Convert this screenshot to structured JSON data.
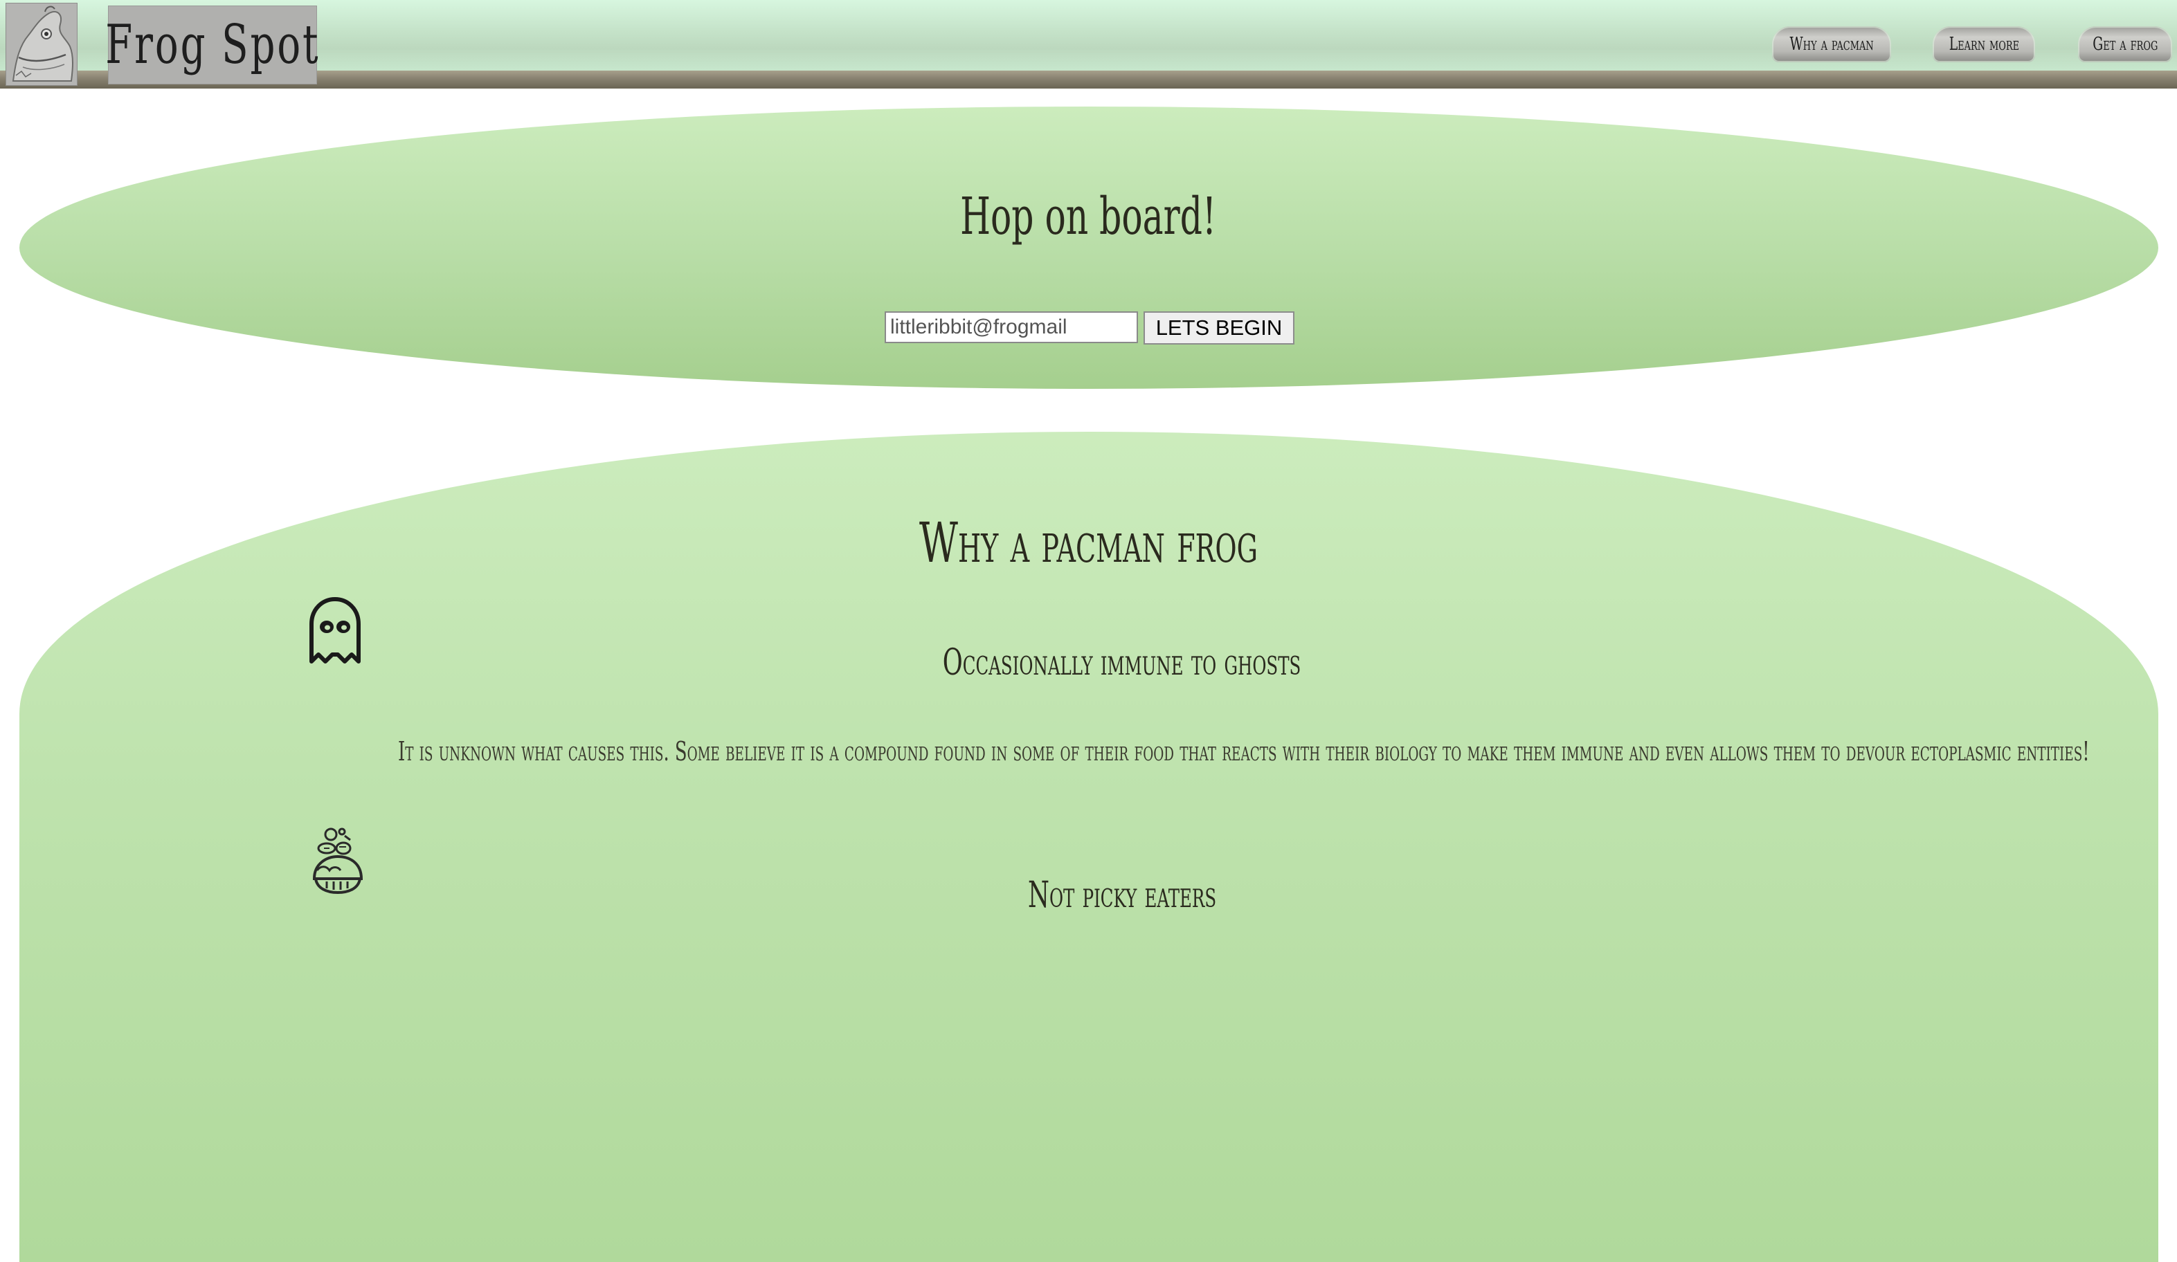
{
  "header": {
    "brand": "Frog Spot",
    "nav": [
      {
        "label": "Why a pacman"
      },
      {
        "label": "Learn more"
      },
      {
        "label": "Get a frog"
      }
    ]
  },
  "hero": {
    "title": "Hop on board!",
    "email_value": "littleribbit@frogmail",
    "button_label": "LETS BEGIN"
  },
  "why": {
    "title": "Why a pacman frog",
    "features": [
      {
        "icon": "ghost-icon",
        "title": "Occasionally immune to ghosts",
        "description": "It is unknown what causes this. Some believe it is a compound found in some of their food that reacts with their biology to make them immune and even allows them to devour ectoplasmic entities!"
      },
      {
        "icon": "food-icon",
        "title": "Not picky eaters",
        "description": ""
      }
    ]
  },
  "colors": {
    "hero_green": "#b9dea8",
    "header_mint": "#c5e3c9",
    "header_brown": "#8b8473"
  }
}
